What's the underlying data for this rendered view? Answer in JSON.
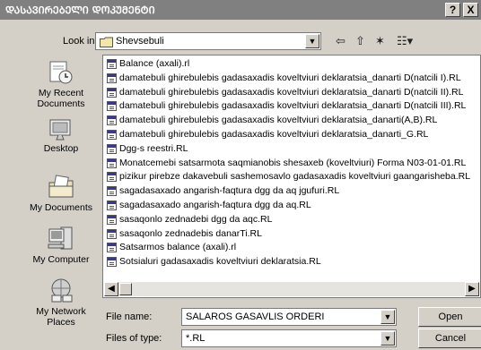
{
  "window": {
    "title": "ᲓᲐᲡᲐᲕᲘᲠᲔᲑᲔᲚᲘ ᲓᲝᲙᲣᲛᲔᲜᲢᲘ",
    "help_label": "?",
    "close_label": "X"
  },
  "lookin": {
    "label": "Look in:",
    "value": "Shevsebuli"
  },
  "toolbar": {
    "back_icon": "⇦",
    "up_icon": "⇧",
    "new_folder_icon": "✶",
    "views_icon": "☷▾"
  },
  "places": [
    {
      "label": "My Recent Documents",
      "icon": "recent-documents-icon"
    },
    {
      "label": "Desktop",
      "icon": "desktop-icon"
    },
    {
      "label": "My Documents",
      "icon": "my-documents-icon"
    },
    {
      "label": "My Computer",
      "icon": "my-computer-icon"
    },
    {
      "label": "My Network Places",
      "icon": "network-places-icon"
    }
  ],
  "files": [
    "Balance (axali).rl",
    "damatebuli ghirebulebis gadasaxadis koveltviuri deklaratsia_danarti D(natcili I).RL",
    "damatebuli ghirebulebis gadasaxadis koveltviuri deklaratsia_danarti D(natcili II).RL",
    "damatebuli ghirebulebis gadasaxadis koveltviuri deklaratsia_danarti D(natcili III).RL",
    "damatebuli ghirebulebis gadasaxadis koveltviuri deklaratsia_danarti(A,B).RL",
    "damatebuli ghirebulebis gadasaxadis koveltviuri deklaratsia_danarti_G.RL",
    "Dgg-s reestri.RL",
    "Monatcemebi satsarmota saqmianobis shesaxeb (koveltviuri) Forma N03-01-01.RL",
    "pizikur pirebze dakavebuli sashemosavlo gadasaxadis koveltviuri gaangarisheba.RL",
    "sagadasaxado angarish-faqtura dgg da aq jgufuri.RL",
    "sagadasaxado angarish-faqtura dgg da aq.RL",
    "sasaqonlo zednadebi dgg da aqc.RL",
    "sasaqonlo zednadebis danarTi.RL",
    "Satsarmos balance (axali).rl",
    "Sotsialuri gadasaxadis koveltviuri deklaratsia.RL"
  ],
  "filename": {
    "label": "File name:",
    "value": "SALAROS GASAVLIS ORDERI"
  },
  "filetype": {
    "label": "Files of type:",
    "value": "*.RL"
  },
  "buttons": {
    "open": "Open",
    "cancel": "Cancel"
  }
}
